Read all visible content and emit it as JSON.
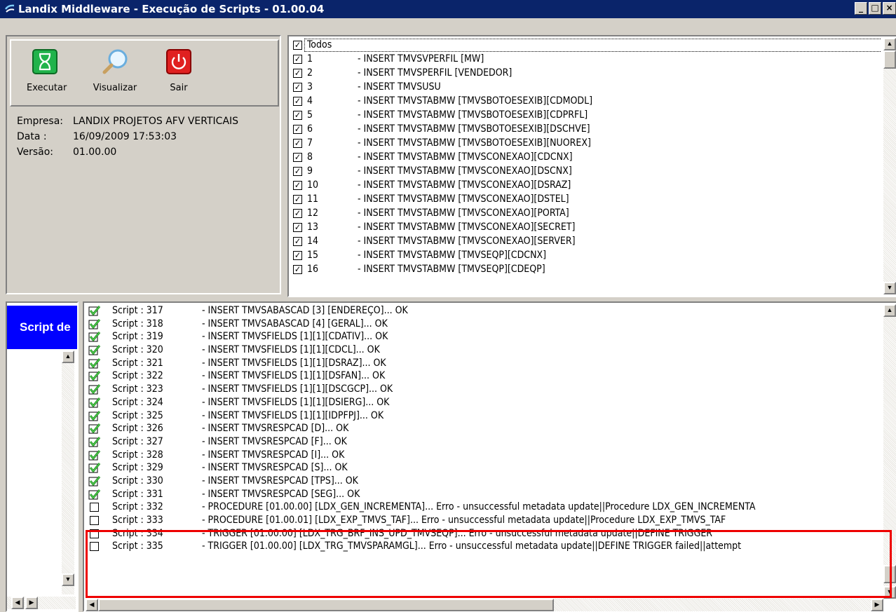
{
  "window": {
    "title": "Landix Middleware - Execução de Scripts - 01.00.04",
    "minimize": "_",
    "maximize": "□",
    "close": "×"
  },
  "toolbar": {
    "execute_label": "Executar",
    "view_label": "Visualizar",
    "exit_label": "Sair"
  },
  "info": {
    "company_label": "Empresa:",
    "company_value": "LANDIX PROJETOS AFV VERTICAIS",
    "date_label": "Data :",
    "date_value": "16/09/2009 17:53:03",
    "version_label": "Versão:",
    "version_value": "01.00.00"
  },
  "checklist": {
    "all_label": "Todos",
    "items": [
      {
        "num": "1",
        "text": "- INSERT TMVSVPERFIL [MW]"
      },
      {
        "num": "2",
        "text": "- INSERT TMVSPERFIL [VENDEDOR]"
      },
      {
        "num": "3",
        "text": "- INSERT TMVSUSU"
      },
      {
        "num": "4",
        "text": "- INSERT TMVSTABMW [TMVSBOTOESEXIB][CDMODL]"
      },
      {
        "num": "5",
        "text": "- INSERT TMVSTABMW [TMVSBOTOESEXIB][CDPRFL]"
      },
      {
        "num": "6",
        "text": "- INSERT TMVSTABMW [TMVSBOTOESEXIB][DSCHVE]"
      },
      {
        "num": "7",
        "text": "- INSERT TMVSTABMW [TMVSBOTOESEXIB][NUOREX]"
      },
      {
        "num": "8",
        "text": "- INSERT TMVSTABMW [TMVSCONEXAO][CDCNX]"
      },
      {
        "num": "9",
        "text": "- INSERT TMVSTABMW [TMVSCONEXAO][DSCNX]"
      },
      {
        "num": "10",
        "text": "- INSERT TMVSTABMW [TMVSCONEXAO][DSRAZ]"
      },
      {
        "num": "11",
        "text": "- INSERT TMVSTABMW [TMVSCONEXAO][DSTEL]"
      },
      {
        "num": "12",
        "text": "- INSERT TMVSTABMW [TMVSCONEXAO][PORTA]"
      },
      {
        "num": "13",
        "text": "- INSERT TMVSTABMW [TMVSCONEXAO][SECRET]"
      },
      {
        "num": "14",
        "text": "- INSERT TMVSTABMW [TMVSCONEXAO][SERVER]"
      },
      {
        "num": "15",
        "text": "- INSERT TMVSTABMW [TMVSEQP][CDCNX]"
      },
      {
        "num": "16",
        "text": "- INSERT TMVSTABMW [TMVSEQP][CDEQP]"
      }
    ]
  },
  "side_tab": {
    "label": "Script de"
  },
  "log": {
    "rows": [
      {
        "ok": true,
        "script": "Script : 317",
        "text": "- INSERT TMVSABASCAD [3] [ENDEREÇO]... OK"
      },
      {
        "ok": true,
        "script": "Script : 318",
        "text": "- INSERT TMVSABASCAD [4] [GERAL]... OK"
      },
      {
        "ok": true,
        "script": "Script : 319",
        "text": "- INSERT TMVSFIELDS [1][1][CDATIV]... OK"
      },
      {
        "ok": true,
        "script": "Script : 320",
        "text": "- INSERT TMVSFIELDS [1][1][CDCL]... OK"
      },
      {
        "ok": true,
        "script": "Script : 321",
        "text": "- INSERT TMVSFIELDS [1][1][DSRAZ]... OK"
      },
      {
        "ok": true,
        "script": "Script : 322",
        "text": "- INSERT TMVSFIELDS [1][1][DSFAN]... OK"
      },
      {
        "ok": true,
        "script": "Script : 323",
        "text": "- INSERT TMVSFIELDS [1][1][DSCGCP]... OK"
      },
      {
        "ok": true,
        "script": "Script : 324",
        "text": "- INSERT TMVSFIELDS [1][1][DSIERG]... OK"
      },
      {
        "ok": true,
        "script": "Script : 325",
        "text": "- INSERT TMVSFIELDS [1][1][IDPFPJ]... OK"
      },
      {
        "ok": true,
        "script": "Script : 326",
        "text": "- INSERT TMVSRESPCAD [D]... OK"
      },
      {
        "ok": true,
        "script": "Script : 327",
        "text": "- INSERT TMVSRESPCAD [F]... OK"
      },
      {
        "ok": true,
        "script": "Script : 328",
        "text": "- INSERT TMVSRESPCAD [I]... OK"
      },
      {
        "ok": true,
        "script": "Script : 329",
        "text": "- INSERT TMVSRESPCAD [S]... OK"
      },
      {
        "ok": true,
        "script": "Script : 330",
        "text": "- INSERT TMVSRESPCAD [TPS]... OK"
      },
      {
        "ok": true,
        "script": "Script : 331",
        "text": "- INSERT TMVSRESPCAD [SEG]... OK"
      },
      {
        "ok": false,
        "script": "Script : 332",
        "text": "- PROCEDURE [01.00.00] [LDX_GEN_INCREMENTA]... Erro - unsuccessful metadata update||Procedure LDX_GEN_INCREMENTA"
      },
      {
        "ok": false,
        "script": "Script : 333",
        "text": "- PROCEDURE [01.00.01] [LDX_EXP_TMVS_TAF]... Erro - unsuccessful metadata update||Procedure LDX_EXP_TMVS_TAF"
      },
      {
        "ok": false,
        "script": "Script : 334",
        "text": "- TRIGGER [01.00.00] [LDX_TRG_BRF_INS_UPD_TMVSEQP]... Erro - unsuccessful metadata update||DEFINE TRIGGER"
      },
      {
        "ok": false,
        "script": "Script : 335",
        "text": "- TRIGGER [01.00.00] [LDX_TRG_TMVSPARAMGL]... Erro - unsuccessful metadata update||DEFINE TRIGGER failed||attempt"
      }
    ]
  },
  "colors": {
    "titlebar": "#0a246a",
    "face": "#d4d0c8",
    "highlight": "#0000ff",
    "error_outline": "#e00000"
  }
}
